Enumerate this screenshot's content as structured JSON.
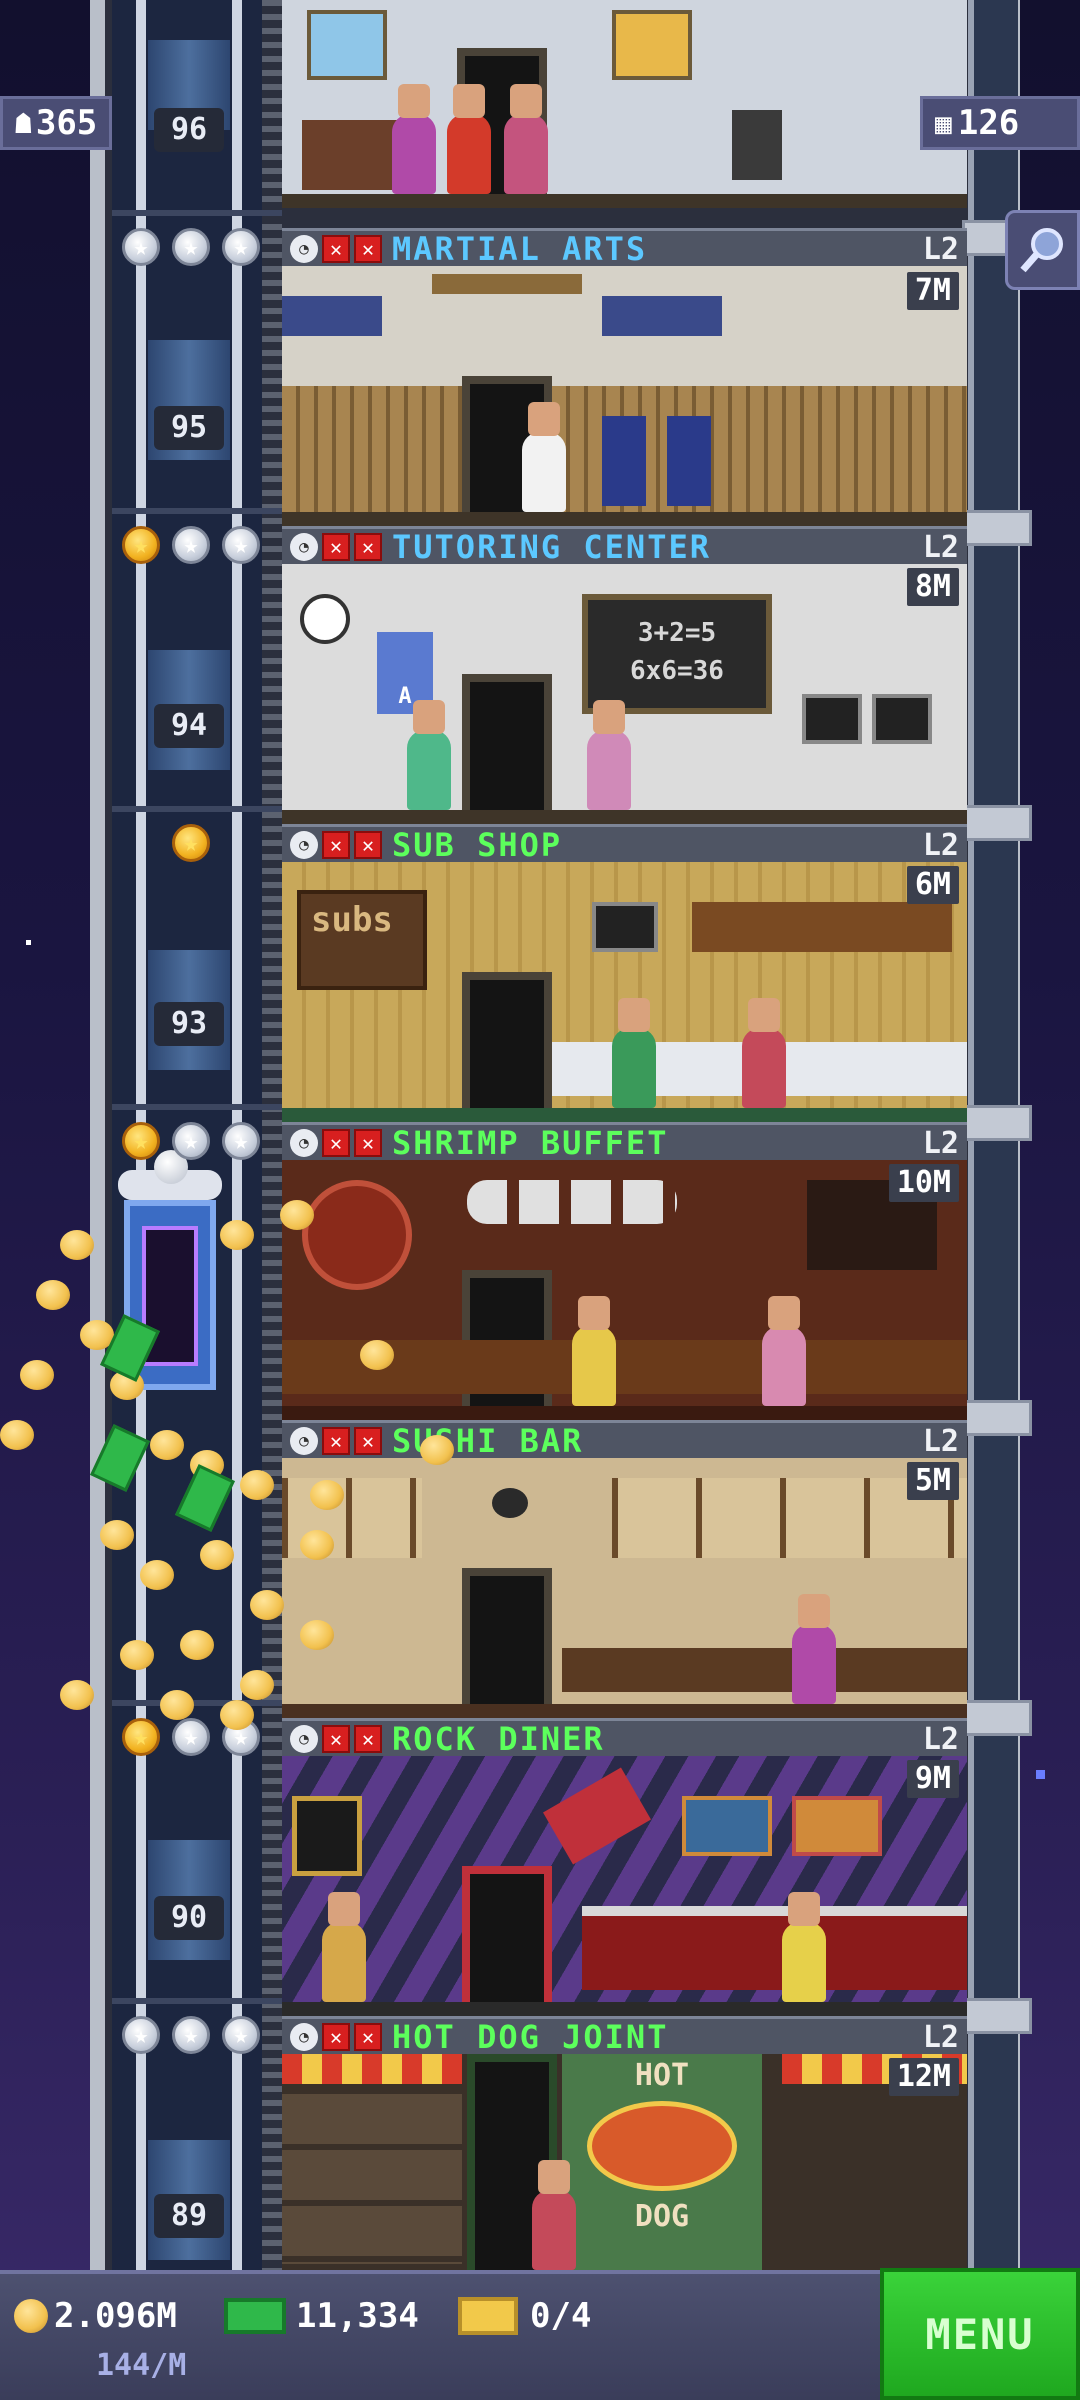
{
  "hud": {
    "population": "365",
    "population_icon": "person-icon",
    "floors_count": "126",
    "floors_icon": "building-icon",
    "search_icon": "magnifier-icon"
  },
  "shaft_labels": [
    "96",
    "95",
    "94",
    "93",
    "90",
    "89"
  ],
  "floors": [
    {
      "name": "MARTIAL ARTS",
      "level": "L2",
      "price": "7M",
      "name_color": "#5cc8ff",
      "stars": [
        "silver",
        "silver",
        "silver"
      ]
    },
    {
      "name": "TUTORING CENTER",
      "level": "L2",
      "price": "8M",
      "name_color": "#5cc8ff",
      "stars": [
        "gold",
        "silver",
        "silver"
      ]
    },
    {
      "name": "SUB SHOP",
      "level": "L2",
      "price": "6M",
      "name_color": "#5cff5c",
      "stars": [
        "gold"
      ]
    },
    {
      "name": "SHRIMP BUFFET",
      "level": "L2",
      "price": "10M",
      "name_color": "#5cff5c",
      "stars": [
        "gold",
        "silver",
        "silver"
      ]
    },
    {
      "name": "SUSHI BAR",
      "level": "L2",
      "price": "5M",
      "name_color": "#5cff5c",
      "stars": []
    },
    {
      "name": "ROCK DINER",
      "level": "L2",
      "price": "9M",
      "name_color": "#5cff5c",
      "stars": [
        "gold",
        "silver",
        "silver"
      ]
    },
    {
      "name": "HOT DOG JOINT",
      "level": "L2",
      "price": "12M",
      "name_color": "#5cff5c",
      "stars": [
        "silver",
        "silver",
        "silver"
      ]
    }
  ],
  "scene_text": {
    "tutoring_board_line1": "3+2=5",
    "tutoring_board_line2": "6x6=36",
    "sub_sign": "subs",
    "hotdog_sign_top": "HOT",
    "hotdog_sign_bottom": "DOG",
    "apple_card": "A"
  },
  "bottom": {
    "coins": "2.096M",
    "coins_per_min": "144/M",
    "bux": "11,334",
    "tickets": "0/4",
    "menu_label": "MENU"
  },
  "colors": {
    "accent_green": "#2ec92e",
    "gold": "#f2b220",
    "bux_green": "#2fb84a"
  }
}
